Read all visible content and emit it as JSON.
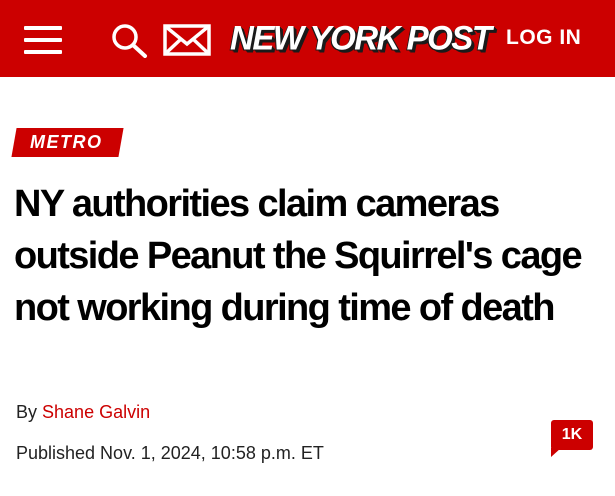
{
  "header": {
    "menu_icon": "hamburger-icon",
    "search_icon": "search-icon",
    "mail_icon": "mail-icon",
    "logo_text": "NEW YORK POST",
    "login_label": "LOG IN",
    "brand_color": "#cc0000"
  },
  "article": {
    "section": "METRO",
    "headline": "NY authorities claim cameras outside Peanut the Squirrel's cage not working during time of death",
    "byline_prefix": "By",
    "author": "Shane Galvin",
    "published": "Published Nov. 1, 2024, 10:58 p.m. ET",
    "comments_count": "1K",
    "comments_icon": "comment-bubble-icon"
  }
}
